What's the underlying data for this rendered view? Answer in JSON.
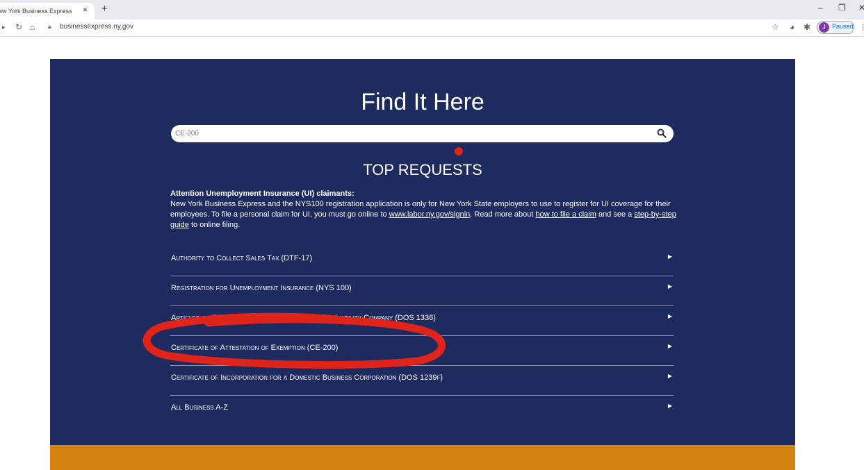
{
  "browser": {
    "tab_title": "ew York Business Express",
    "tab_close": "×",
    "new_tab": "+",
    "url": "businessexpress.ny.gov",
    "profile_initial": "J",
    "profile_status": "Paused"
  },
  "page": {
    "title": "Find It Here",
    "search": {
      "value": "CE-200"
    },
    "top_requests_heading": "TOP REQUESTS",
    "notice": {
      "heading": "Attention Unemployment Insurance (UI) claimants:",
      "text_1": "New York Business Express and the NYS100 registration application is only for New York State employers to use to register for UI coverage for their employees. To file a personal claim for UI, you must go online to ",
      "link_1": "www.labor.ny.gov/signin",
      "text_2": ". Read more about ",
      "link_2": "how to file a claim",
      "text_3": " and see a ",
      "link_3": "step-by-step guide",
      "text_4": " to online filing."
    },
    "requests": [
      {
        "label": "Authority to Collect Sales Tax (DTF-17)"
      },
      {
        "label": "Registration for Unemployment Insurance (NYS 100)"
      },
      {
        "label": "Articles of Organization for a Domestic Limited Liability Company (DOS 1336)"
      },
      {
        "label": "Certificate of Attestation of Exemption (CE-200)"
      },
      {
        "label": "Certificate of Incorporation for a Domestic Business Corporation (DOS 1239f)"
      },
      {
        "label": "All Business A-Z"
      }
    ]
  },
  "colors": {
    "hero_bg": "#1e2b5e",
    "footer_band": "#d3810f",
    "annotation": "#e0231b"
  }
}
